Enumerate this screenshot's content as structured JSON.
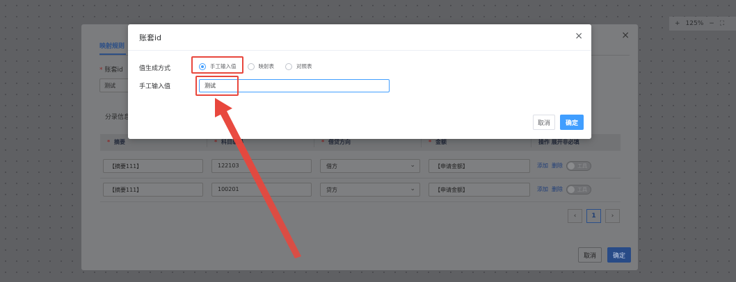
{
  "zoom": {
    "zoom_in": "+",
    "level": "125%",
    "zoom_out": "−",
    "fit": "⛶"
  },
  "outer": {
    "tab": "映射规则",
    "field_required": "*",
    "field_label": "账套id",
    "field_value": "测试",
    "section_label": "分录信息",
    "columns": [
      {
        "req": "*",
        "label": "摘要"
      },
      {
        "req": "*",
        "label": "科目编码"
      },
      {
        "req": "*",
        "label": "借贷方向"
      },
      {
        "req": "*",
        "label": "金额"
      }
    ],
    "actions_header": "操作 展开非必填",
    "rows": [
      {
        "summary": "【摘要111】",
        "code": "122103",
        "direction": "借方",
        "amount": "【申请金额】",
        "add": "添加",
        "del": "删除",
        "toggle": "工具"
      },
      {
        "summary": "【摘要111】",
        "code": "100201",
        "direction": "贷方",
        "amount": "【申请金额】",
        "add": "添加",
        "del": "删除",
        "toggle": "工具"
      }
    ],
    "pager": {
      "prev": "‹",
      "page": "1",
      "next": "›"
    },
    "cancel": "取消",
    "ok": "确定"
  },
  "modal": {
    "title": "账套id",
    "gen_label": "值生成方式",
    "options": [
      "手工输入值",
      "映射表",
      "对照表"
    ],
    "selected": 0,
    "manual_label": "手工输入值",
    "manual_value": "测试",
    "cancel": "取消",
    "ok": "确定"
  },
  "colors": {
    "accent": "#409eff",
    "annotation": "#e8463c"
  }
}
